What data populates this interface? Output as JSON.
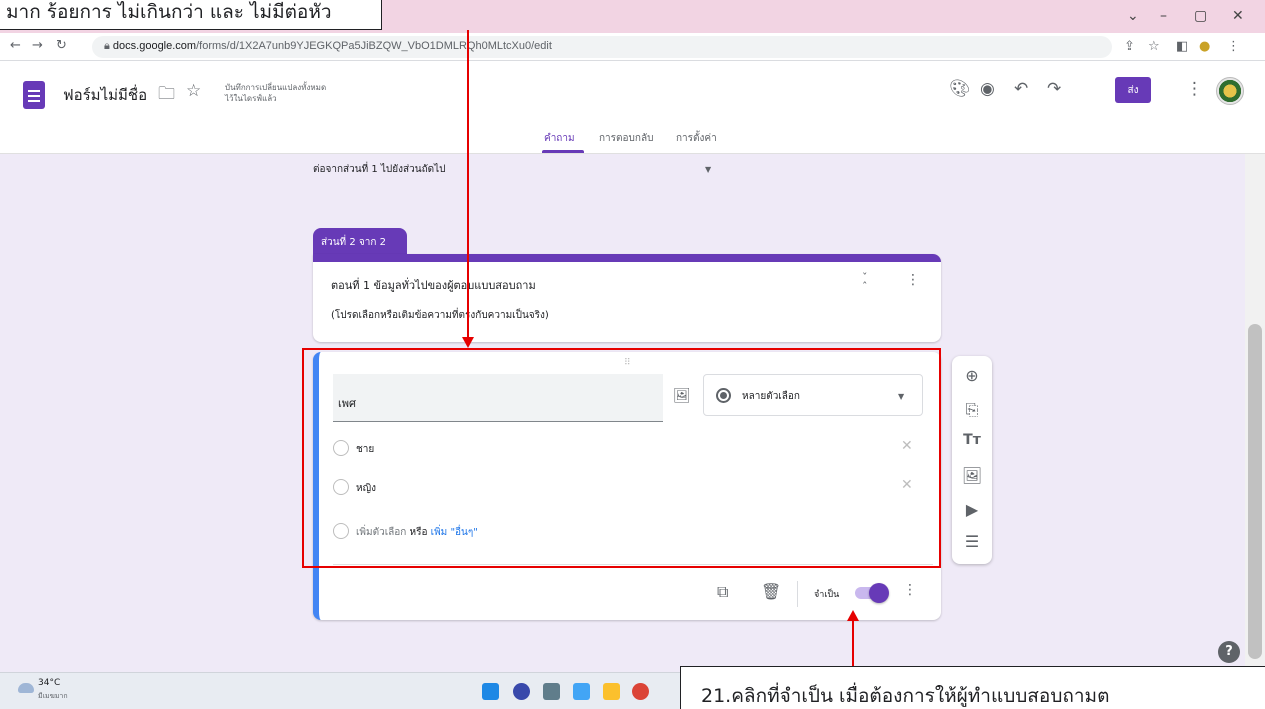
{
  "browser": {
    "url_domain": "docs.google.com",
    "url_path": "/forms/d/1X2A7unb9YJEGKQPa5JiBZQW_VbO1DMLRQh0MLtcXu0/edit"
  },
  "header": {
    "form_title": "ฟอร์มไม่มีชื่อ",
    "save_status_line1": "บันทึกการเปลี่ยนแปลงทั้งหมด",
    "save_status_line2": "ไว้ในไดรฟ์แล้ว",
    "send_label": "ส่ง",
    "tabs": [
      {
        "label": "คำถาม",
        "active": true
      },
      {
        "label": "การตอบกลับ",
        "active": false
      },
      {
        "label": "การตั้งค่า",
        "active": false
      }
    ]
  },
  "after_section": "ต่อจากส่วนที่ 1   ไปยังส่วนถัดไป",
  "section": {
    "tab_label": "ส่วนที่ 2 จาก 2",
    "title": "ตอนที่ 1  ข้อมูลทั่วไปของผู้ตอบแบบสอบถาม",
    "description": "(โปรดเลือกหรือเติมข้อความที่ตรงกับความเป็นจริง)"
  },
  "question": {
    "title": "เพศ",
    "type_label": "หลายตัวเลือก",
    "options": [
      "ชาย",
      "หญิง"
    ],
    "add_option": "เพิ่มตัวเลือก",
    "or": "หรือ",
    "add_other": "เพิ่ม \"อื่นๆ\"",
    "required_label": "จำเป็น",
    "required_on": true
  },
  "taskbar": {
    "temp": "34°C",
    "weather_desc": "มีเมฆมาก"
  },
  "annotations": {
    "top_callout": "มาก ร้อยการ ไม่เกินกว่า และ ไม่มีต่อหัว",
    "bottom_callout": "21.คลิกที่จำเป็น เมื่อต้องการให้ผู้ทำแบบสอบถามต"
  },
  "colors": {
    "accent": "#673ab7",
    "question_bar": "#4285f4",
    "annotation_red": "#e60000",
    "page_background": "#efeaf7"
  }
}
